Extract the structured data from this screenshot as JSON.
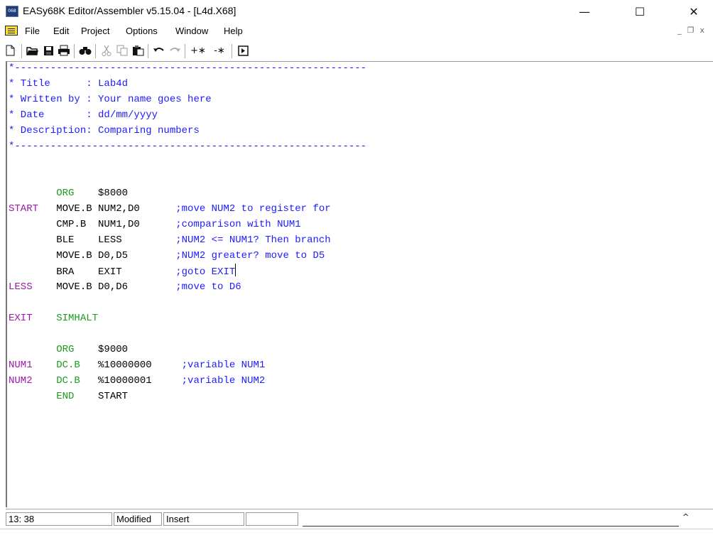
{
  "window": {
    "icon_text": "068",
    "title": "EASy68K Editor/Assembler v5.15.04 - [L4d.X68]",
    "controls": {
      "minimize": "—",
      "maximize": "☐",
      "close": "✕"
    }
  },
  "menubar": {
    "items": [
      "File",
      "Edit",
      "Project",
      "Options",
      "Window",
      "Help"
    ],
    "mdi_controls": [
      "_",
      "❐",
      "x"
    ]
  },
  "toolbar": {
    "buttons": [
      "new-icon",
      "open-icon",
      "save-icon",
      "print-icon",
      "find-icon",
      "cut-icon",
      "copy-icon",
      "paste-icon",
      "undo-icon",
      "redo-icon",
      "comment-add-icon",
      "comment-remove-icon",
      "assemble-icon"
    ],
    "comment_add": "+∗",
    "comment_remove": "-∗"
  },
  "editor": {
    "lines": [
      "*-----------------------------------------------------------",
      "* Title      : Lab4d",
      "* Written by : Your name goes here",
      "* Date       : dd/mm/yyyy",
      "* Description: Comparing numbers",
      "*-----------------------------------------------------------",
      "",
      "",
      "        ORG    $8000",
      "START   MOVE.B NUM2,D0      ;move NUM2 to register for",
      "        CMP.B  NUM1,D0      ;comparison with NUM1",
      "        BLE    LESS         ;NUM2 <= NUM1? Then branch",
      "        MOVE.B D0,D5        ;NUM2 greater? move to D5",
      "        BRA    EXIT         ;goto EXIT",
      "LESS    MOVE.B D0,D6        ;move to D6",
      "",
      "EXIT    SIMHALT",
      "",
      "        ORG    $9000",
      "NUM1    DC.B   %10000000     ;variable NUM1",
      "NUM2    DC.B   %10000001     ;variable NUM2",
      "        END    START"
    ],
    "colors": {
      "comment": "#1c1cff",
      "label": "#9b18a8",
      "directive": "#1d9b1d",
      "opcode": "#000000"
    }
  },
  "statusbar": {
    "position": "13: 38",
    "modified": "Modified",
    "mode": "Insert",
    "message": "",
    "arrow": "^"
  }
}
